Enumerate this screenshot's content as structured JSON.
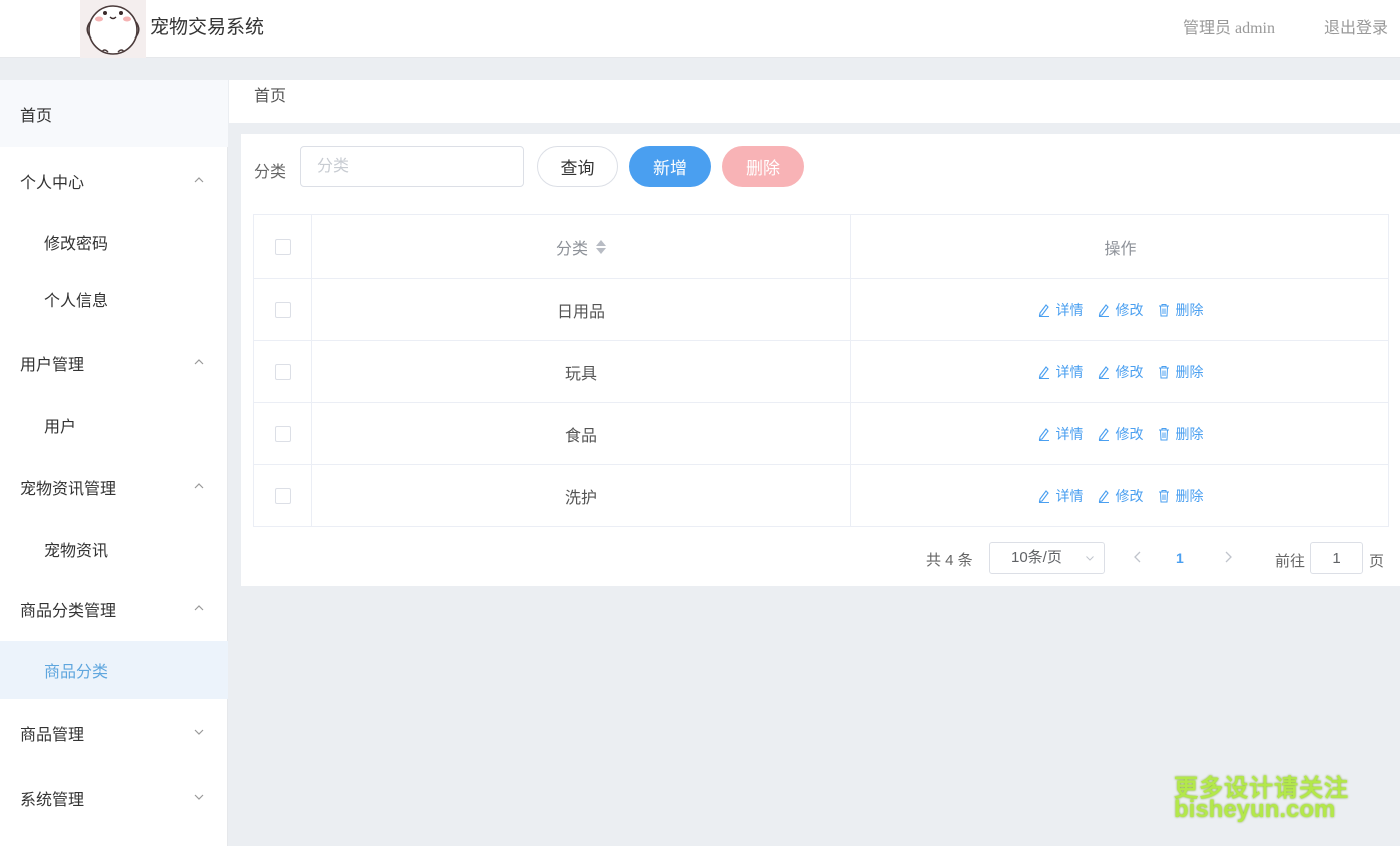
{
  "header": {
    "app_title": "宠物交易系统",
    "user_label": "管理员 admin",
    "logout_label": "退出登录"
  },
  "sidebar": {
    "items": [
      {
        "label": "首页",
        "level": "top",
        "state": "home"
      },
      {
        "label": "个人中心",
        "level": "top",
        "chevron": "up"
      },
      {
        "label": "修改密码",
        "level": "sub"
      },
      {
        "label": "个人信息",
        "level": "sub"
      },
      {
        "label": "用户管理",
        "level": "top",
        "chevron": "up"
      },
      {
        "label": "用户",
        "level": "sub"
      },
      {
        "label": "宠物资讯管理",
        "level": "top",
        "chevron": "up"
      },
      {
        "label": "宠物资讯",
        "level": "sub"
      },
      {
        "label": "商品分类管理",
        "level": "top",
        "chevron": "up"
      },
      {
        "label": "商品分类",
        "level": "sub",
        "state": "active"
      },
      {
        "label": "商品管理",
        "level": "top",
        "chevron": "down"
      },
      {
        "label": "系统管理",
        "level": "top",
        "chevron": "down"
      }
    ]
  },
  "breadcrumb": {
    "current": "首页"
  },
  "filter": {
    "label": "分类",
    "placeholder": "分类",
    "value": "",
    "query_label": "查询",
    "add_label": "新增",
    "delete_label": "删除"
  },
  "table": {
    "headers": {
      "category": "分类",
      "actions": "操作"
    },
    "rows": [
      {
        "category": "日用品"
      },
      {
        "category": "玩具"
      },
      {
        "category": "食品"
      },
      {
        "category": "洗护"
      }
    ],
    "actions": {
      "detail": "详情",
      "edit": "修改",
      "delete": "删除"
    }
  },
  "pagination": {
    "total_text": "共 4 条",
    "page_size": "10条/页",
    "current_page": "1",
    "goto_label": "前往",
    "goto_value": "1",
    "goto_suffix": "页"
  },
  "watermark": {
    "line1": "更多设计请关注",
    "line2": "bisheyun.com"
  },
  "colors": {
    "primary": "#4a9ff0",
    "danger_light": "#f8b3b6",
    "active_menu_bg": "#ecf3fb",
    "active_menu_text": "#5fa6de",
    "page_bg": "#ebeef2"
  },
  "icons": {
    "detail": "edit-pen-icon",
    "edit": "edit-pen-icon",
    "delete": "trash-icon",
    "expand": "chevron-icon"
  }
}
